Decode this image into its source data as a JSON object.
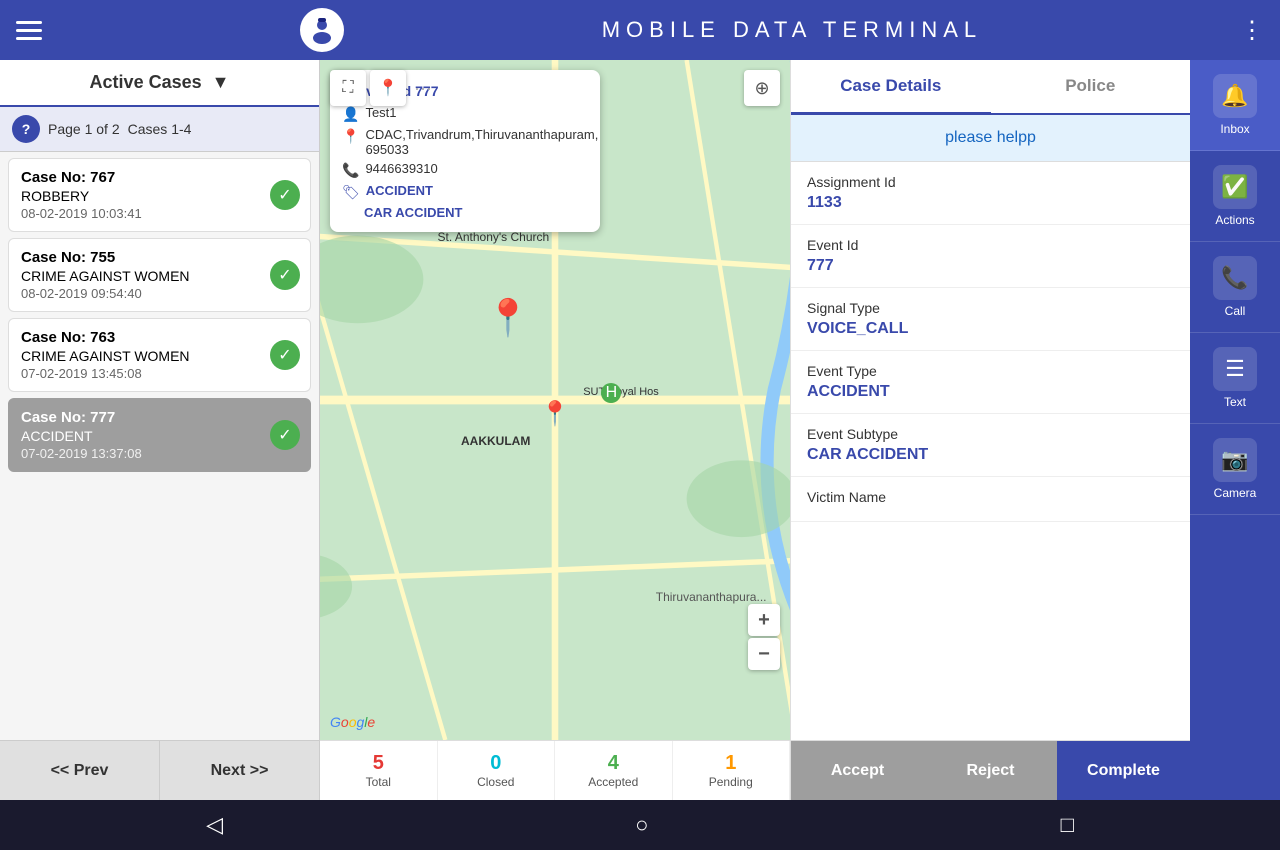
{
  "header": {
    "title": "MOBILE   DATA   TERMINAL",
    "menu_icon": "☰",
    "more_icon": "⋮"
  },
  "left_panel": {
    "active_cases_label": "Active Cases",
    "pagination": {
      "page": "Page 1 of 2",
      "cases": "Cases 1-4"
    },
    "cases": [
      {
        "id": 1,
        "case_no": "Case No: 767",
        "type": "ROBBERY",
        "date": "08-02-2019 10:03:41",
        "active": false
      },
      {
        "id": 2,
        "case_no": "Case No: 755",
        "type": "CRIME AGAINST WOMEN",
        "date": "08-02-2019 09:54:40",
        "active": false
      },
      {
        "id": 3,
        "case_no": "Case No: 763",
        "type": "CRIME AGAINST WOMEN",
        "date": "07-02-2019 13:45:08",
        "active": false
      },
      {
        "id": 4,
        "case_no": "Case No: 777",
        "type": "ACCIDENT",
        "date": "07-02-2019 13:37:08",
        "active": true
      }
    ],
    "prev_btn": "<< Prev",
    "next_btn": "Next >>"
  },
  "map": {
    "event_id_label": "Event Id 777",
    "test_label": "Test1",
    "address": "CDAC,Trivandrum,Thiruvananthapuram, 695033",
    "phone": "9446639310",
    "category": "ACCIDENT",
    "subcategory": "CAR ACCIDENT",
    "labels": {
      "area1": "St. Anthony's Church",
      "area2": "AAKKULAM",
      "hospital": "SUT Royal Hos",
      "city": "Thiruvananthapura..."
    },
    "zoom_in": "+",
    "zoom_out": "−",
    "google_label": "Google"
  },
  "stats": [
    {
      "num": "5",
      "label": "Total",
      "color_class": "total"
    },
    {
      "num": "0",
      "label": "Closed",
      "color_class": "closed"
    },
    {
      "num": "4",
      "label": "Accepted",
      "color_class": "accepted"
    },
    {
      "num": "1",
      "label": "Pending",
      "color_class": "pending"
    }
  ],
  "case_details": {
    "tab_case": "Case Details",
    "tab_police": "Police",
    "title": "please helpp",
    "assignment_id_label": "Assignment Id",
    "assignment_id_value": "1133",
    "event_id_label": "Event Id",
    "event_id_value": "777",
    "signal_type_label": "Signal Type",
    "signal_type_value": "VOICE_CALL",
    "event_type_label": "Event Type",
    "event_type_value": "ACCIDENT",
    "event_subtype_label": "Event Subtype",
    "event_subtype_value": "CAR ACCIDENT",
    "victim_name_label": "Victim Name",
    "btn_accept": "Accept",
    "btn_reject": "Reject",
    "btn_complete": "Complete"
  },
  "sidebar": [
    {
      "icon": "🔔",
      "label": "Inbox"
    },
    {
      "icon": "✅",
      "label": "Actions"
    },
    {
      "icon": "📞",
      "label": "Call"
    },
    {
      "icon": "☰",
      "label": "Text"
    },
    {
      "icon": "📷",
      "label": "Camera"
    }
  ],
  "bottom_nav": {
    "back": "◁",
    "home": "○",
    "square": "□"
  }
}
